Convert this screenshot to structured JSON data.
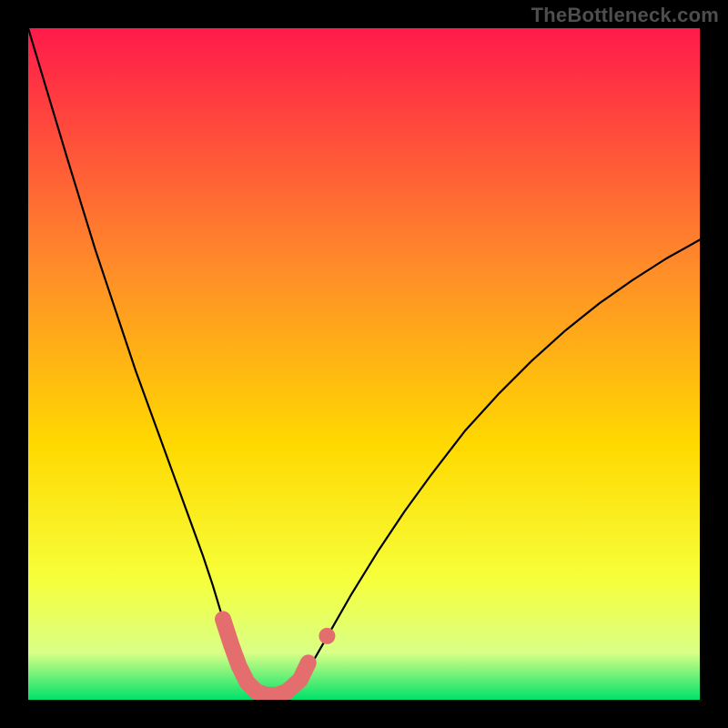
{
  "watermark": "TheBottleneck.com",
  "plot": {
    "margin": 31,
    "inner_size": 738,
    "gradient": {
      "top": "#ff1a4a",
      "mid1": "#ff8a2a",
      "mid2": "#ffd900",
      "mid3": "#f6ff3a",
      "low": "#d9ff86",
      "bottom": "#00e26a"
    }
  },
  "chart_data": {
    "type": "line",
    "title": "",
    "xlabel": "",
    "ylabel": "",
    "xlim": [
      0,
      100
    ],
    "ylim": [
      0,
      100
    ],
    "grid": false,
    "legend": "none",
    "annotations": [],
    "series": [
      {
        "name": "curve",
        "comment": "Main black bottleneck curve. x is normalized 0–100 across plot width, y is 0 (bottom) to 100 (top). Values estimated from rendered pixels.",
        "x": [
          0.0,
          1.5,
          3.0,
          4.5,
          6.0,
          8.0,
          10.0,
          12.0,
          14.0,
          16.0,
          18.0,
          20.0,
          22.0,
          24.0,
          26.0,
          27.5,
          29.0,
          30.7,
          31.8,
          33.0,
          34.5,
          36.0,
          38.0,
          40.0,
          42.0,
          44.0,
          48.0,
          52.0,
          56.0,
          60.0,
          65.0,
          70.0,
          75.0,
          80.0,
          85.0,
          90.0,
          95.0,
          100.0
        ],
        "y": [
          100.0,
          95.0,
          90.0,
          85.0,
          80.0,
          73.5,
          67.0,
          61.0,
          55.0,
          49.0,
          43.5,
          38.0,
          32.5,
          27.0,
          21.5,
          17.0,
          12.0,
          7.0,
          4.0,
          1.8,
          0.7,
          0.3,
          0.6,
          2.0,
          5.0,
          8.5,
          15.5,
          22.0,
          28.0,
          33.5,
          40.0,
          45.5,
          50.5,
          55.0,
          59.0,
          62.5,
          65.7,
          68.5
        ]
      },
      {
        "name": "highlight",
        "comment": "Thick salmon overlay segment near the trough.",
        "x": [
          29.0,
          30.3,
          31.4,
          32.6,
          34.0,
          35.5,
          37.0,
          38.5,
          40.5,
          41.7
        ],
        "y": [
          12.0,
          8.0,
          5.0,
          2.6,
          1.2,
          0.7,
          0.7,
          1.2,
          3.0,
          5.5
        ]
      },
      {
        "name": "highlight-dot",
        "comment": "Detached salmon dot to the right of the main highlight.",
        "x": [
          44.5
        ],
        "y": [
          9.5
        ]
      }
    ],
    "colors": {
      "curve": "#000000",
      "highlight": "#e46d6d"
    }
  }
}
